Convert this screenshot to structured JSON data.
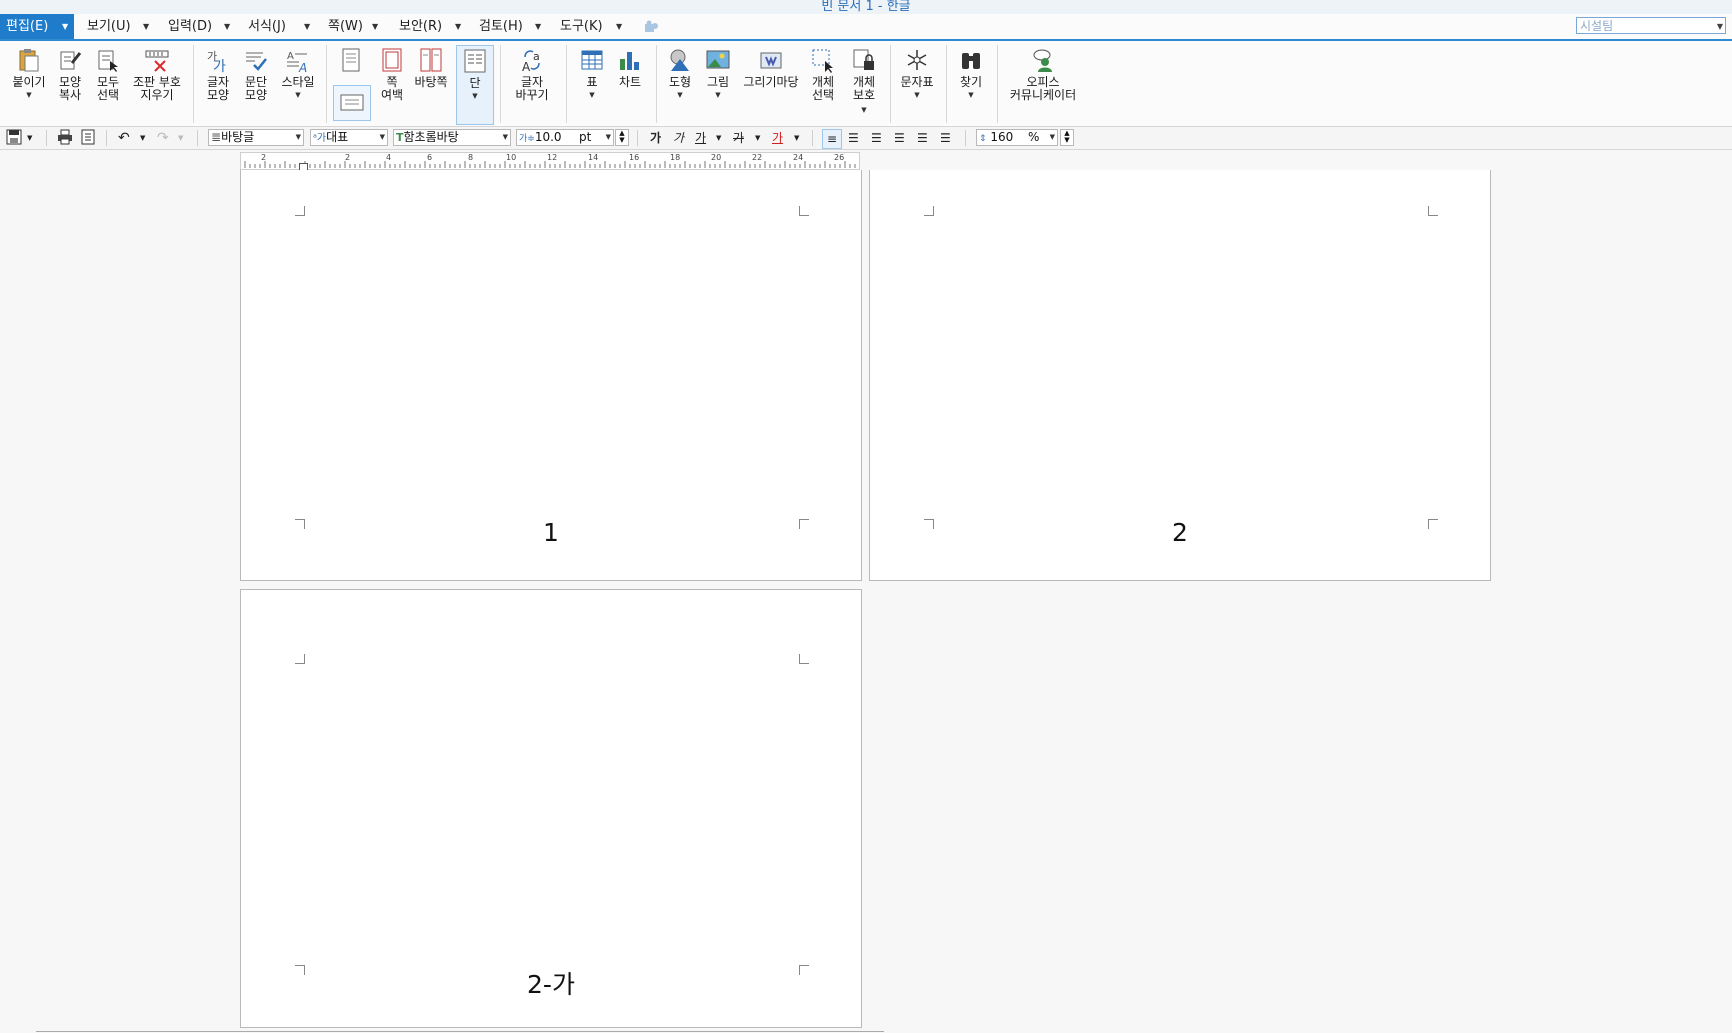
{
  "window": {
    "title": "빈 문서 1 - 한글"
  },
  "menu": {
    "items": [
      "편집(E)",
      "보기(U)",
      "입력(D)",
      "서식(J)",
      "쪽(W)",
      "보안(R)",
      "검토(H)",
      "도구(K)"
    ],
    "active": "편집(E)",
    "search_placeholder": "시설팀"
  },
  "ribbon": {
    "paste": "붙이기",
    "copy_format": "모양\n복사",
    "select_all": "모두\n선택",
    "clear_markup": "조판 부호\n지우기",
    "char_shape": "글자\n모양",
    "para_shape": "문단\n모양",
    "style": "스타일",
    "page_margin": "쪽\n여백",
    "master_page": "바탕쪽",
    "column": "단",
    "char_replace": "글자\n바꾸기",
    "table": "표",
    "chart": "차트",
    "shape": "도형",
    "picture": "그림",
    "gallery": "그리기마당",
    "object_select": "개체\n선택",
    "object_protect": "개체\n보호",
    "char_map": "문자표",
    "find": "찾기",
    "office_communicator": "오피스\n커뮤니케이터"
  },
  "toolbar": {
    "style_value": "바탕글",
    "lang_value": "대표",
    "font_value": "함초롬바탕",
    "size_value": "10.0",
    "size_unit": "pt",
    "bold": "가",
    "italic": "가",
    "underline": "가",
    "strike": "가",
    "font_color": "가",
    "line_spacing_value": "160",
    "line_spacing_unit": "%"
  },
  "ruler": {
    "ticks": [
      "2",
      "2",
      "4",
      "6",
      "8",
      "10",
      "12",
      "14",
      "16",
      "18",
      "20",
      "22",
      "24",
      "26"
    ]
  },
  "pages": [
    {
      "label": "1"
    },
    {
      "label": "2"
    },
    {
      "label": "2-가"
    }
  ],
  "colors": {
    "accent": "#1f7ccb",
    "title": "#2a6fb8"
  }
}
